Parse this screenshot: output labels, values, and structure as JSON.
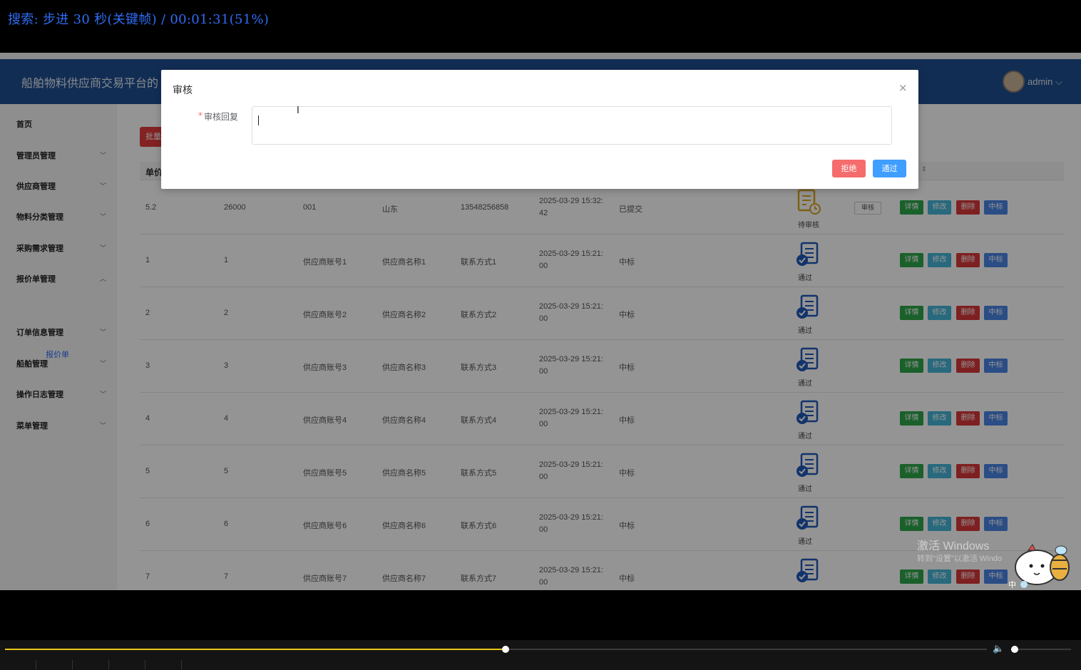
{
  "player": {
    "osd_text": "搜索: 步进 30 秒(关键帧) / 00:01:31(51%)",
    "progress_fraction": 0.51,
    "volume_fraction": 0.06
  },
  "app": {
    "title": "船舶物料供应商交易平台的",
    "user": "admin",
    "delete_button": "批量删除"
  },
  "sidebar": {
    "items": [
      {
        "label": "首页",
        "expandable": false
      },
      {
        "label": "管理员管理",
        "expandable": true
      },
      {
        "label": "供应商管理",
        "expandable": true
      },
      {
        "label": "物料分类管理",
        "expandable": true
      },
      {
        "label": "采购需求管理",
        "expandable": true
      },
      {
        "label": "报价单管理",
        "expandable": true,
        "expanded": true
      },
      {
        "label": "订单信息管理",
        "expandable": true
      },
      {
        "label": "船舶管理",
        "expandable": true
      },
      {
        "label": "操作日志管理",
        "expandable": true
      },
      {
        "label": "菜单管理",
        "expandable": true
      }
    ],
    "sub_item": "报价单"
  },
  "table": {
    "header_first": "单价",
    "rows": [
      {
        "c1": "5.2",
        "c2": "26000",
        "c3": "001",
        "c4": "山东",
        "c5": "13548256858",
        "time1": "2025-03-29 15:32:",
        "time2": "42",
        "status": "已提交",
        "audit": "待审核",
        "audit_button": "审核"
      },
      {
        "c1": "1",
        "c2": "1",
        "c3": "供应商账号1",
        "c4": "供应商名称1",
        "c5": "联系方式1",
        "time1": "2025-03-29 15:21:",
        "time2": "00",
        "status": "中标",
        "audit": "通过"
      },
      {
        "c1": "2",
        "c2": "2",
        "c3": "供应商账号2",
        "c4": "供应商名称2",
        "c5": "联系方式2",
        "time1": "2025-03-29 15:21:",
        "time2": "00",
        "status": "中标",
        "audit": "通过"
      },
      {
        "c1": "3",
        "c2": "3",
        "c3": "供应商账号3",
        "c4": "供应商名称3",
        "c5": "联系方式3",
        "time1": "2025-03-29 15:21:",
        "time2": "00",
        "status": "中标",
        "audit": "通过"
      },
      {
        "c1": "4",
        "c2": "4",
        "c3": "供应商账号4",
        "c4": "供应商名称4",
        "c5": "联系方式4",
        "time1": "2025-03-29 15:21:",
        "time2": "00",
        "status": "中标",
        "audit": "通过"
      },
      {
        "c1": "5",
        "c2": "5",
        "c3": "供应商账号5",
        "c4": "供应商名称5",
        "c5": "联系方式5",
        "time1": "2025-03-29 15:21:",
        "time2": "00",
        "status": "中标",
        "audit": "通过"
      },
      {
        "c1": "6",
        "c2": "6",
        "c3": "供应商账号6",
        "c4": "供应商名称6",
        "c5": "联系方式6",
        "time1": "2025-03-29 15:21:",
        "time2": "00",
        "status": "中标",
        "audit": "通过"
      },
      {
        "c1": "7",
        "c2": "7",
        "c3": "供应商账号7",
        "c4": "供应商名称7",
        "c5": "联系方式7",
        "time1": "2025-03-29 15:21:",
        "time2": "00",
        "status": "中标",
        "audit": ""
      }
    ],
    "actions": {
      "detail": "详情",
      "edit": "修改",
      "delete": "删除",
      "win": "中标"
    }
  },
  "dialog": {
    "title": "审核",
    "close": "×",
    "required_mark": "*",
    "field_label": "审核回复",
    "field_value": "",
    "reject": "拒绝",
    "approve": "通过"
  },
  "watermark": {
    "line1": "激活 Windows",
    "line2": "转到\"设置\"以激活 Windo"
  }
}
